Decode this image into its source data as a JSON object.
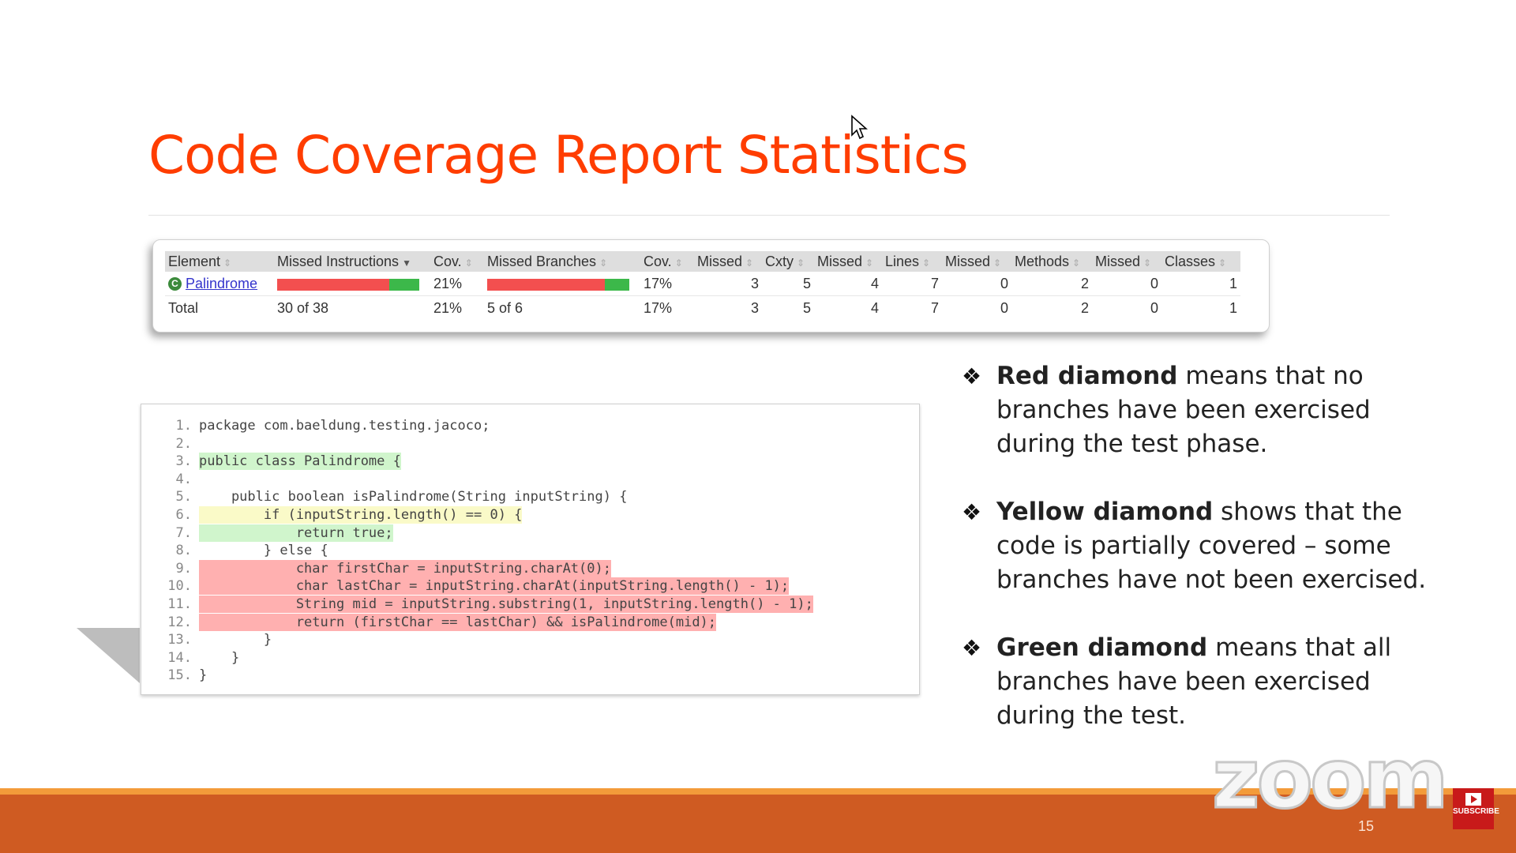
{
  "slide": {
    "title": "Code Coverage Report Statistics",
    "page_number": "15"
  },
  "coverage_table": {
    "headers": [
      "Element",
      "Missed Instructions",
      "Cov.",
      "Missed Branches",
      "Cov.",
      "Missed",
      "Cxty",
      "Missed",
      "Lines",
      "Missed",
      "Methods",
      "Missed",
      "Classes"
    ],
    "rows": [
      {
        "element": "Palindrome",
        "instructions_missed_fraction": 0.79,
        "instructions_cov": "21%",
        "branches_missed_fraction": 0.83,
        "branches_cov": "17%",
        "cxty_missed": "3",
        "cxty": "5",
        "lines_missed": "4",
        "lines": "7",
        "methods_missed": "0",
        "methods": "2",
        "classes_missed": "0",
        "classes": "1"
      }
    ],
    "total": {
      "element": "Total",
      "instructions": "30 of 38",
      "instructions_cov": "21%",
      "branches": "5 of 6",
      "branches_cov": "17%",
      "cxty_missed": "3",
      "cxty": "5",
      "lines_missed": "4",
      "lines": "7",
      "methods_missed": "0",
      "methods": "2",
      "classes_missed": "0",
      "classes": "1"
    },
    "colors": {
      "missed": "#f34f4f",
      "covered": "#3cb84a"
    }
  },
  "code": {
    "lines": [
      {
        "n": "1.",
        "text": "package com.baeldung.testing.jacoco;",
        "status": "none",
        "marker": ""
      },
      {
        "n": "2.",
        "text": "",
        "status": "none",
        "marker": ""
      },
      {
        "n": "3.",
        "text": "public class Palindrome {",
        "status": "green",
        "marker": ""
      },
      {
        "n": "4.",
        "text": "",
        "status": "none",
        "marker": ""
      },
      {
        "n": "5.",
        "text": "    public boolean isPalindrome(String inputString) {",
        "status": "none",
        "marker": ""
      },
      {
        "n": "6.",
        "text": "        if (inputString.length() == 0) {",
        "status": "yellow",
        "marker": "yellow"
      },
      {
        "n": "7.",
        "text": "            return true;",
        "status": "green",
        "marker": ""
      },
      {
        "n": "8.",
        "text": "        } else {",
        "status": "none",
        "marker": ""
      },
      {
        "n": "9.",
        "text": "            char firstChar = inputString.charAt(0);",
        "status": "red",
        "marker": ""
      },
      {
        "n": "10.",
        "text": "            char lastChar = inputString.charAt(inputString.length() - 1);",
        "status": "red",
        "marker": ""
      },
      {
        "n": "11.",
        "text": "            String mid = inputString.substring(1, inputString.length() - 1);",
        "status": "red",
        "marker": ""
      },
      {
        "n": "12.",
        "text": "            return (firstChar == lastChar) && isPalindrome(mid);",
        "status": "red",
        "marker": "red"
      },
      {
        "n": "13.",
        "text": "        }",
        "status": "none",
        "marker": ""
      },
      {
        "n": "14.",
        "text": "    }",
        "status": "none",
        "marker": ""
      },
      {
        "n": "15.",
        "text": "}",
        "status": "none",
        "marker": ""
      }
    ]
  },
  "bullets": [
    {
      "mark": "❖",
      "bold": "Red diamond",
      "text": " means that no branches have been exercised during the test phase."
    },
    {
      "mark": "❖",
      "bold": "Yellow diamond",
      "text": " shows that the code is partially covered – some branches have not been exercised."
    },
    {
      "mark": "❖",
      "bold": "Green diamond",
      "text": " means that all branches have been exercised during the test."
    }
  ],
  "overlay": {
    "watermark": "zoom",
    "subscribe_label": "SUBSCRIBE"
  },
  "icons": {
    "cursor": "cursor-arrow-icon",
    "class": "class-icon",
    "bullet": "diamond-bullet-icon",
    "subscribe": "play-icon"
  }
}
